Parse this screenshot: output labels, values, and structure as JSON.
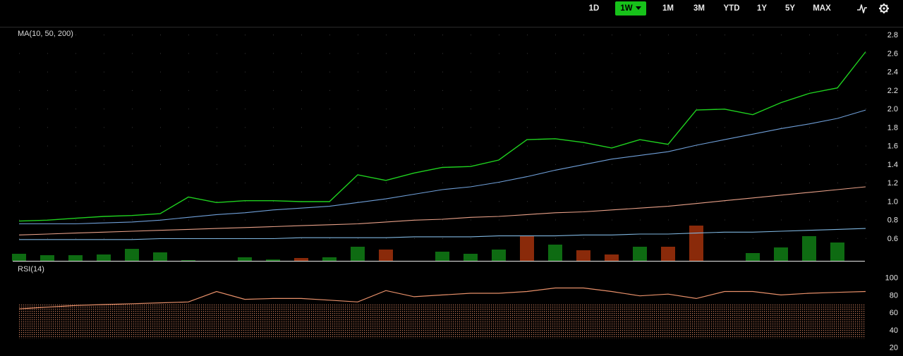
{
  "toolbar": {
    "ranges": [
      {
        "label": "1D",
        "active": false
      },
      {
        "label": "1W",
        "active": true
      },
      {
        "label": "1M",
        "active": false
      },
      {
        "label": "3M",
        "active": false
      },
      {
        "label": "YTD",
        "active": false
      },
      {
        "label": "1Y",
        "active": false
      },
      {
        "label": "5Y",
        "active": false
      },
      {
        "label": "MAX",
        "active": false
      }
    ],
    "icons": [
      "chart-type-icon",
      "gear-icon"
    ]
  },
  "colors": {
    "price": "#1fd11f",
    "ma10": "#6f9fd8",
    "ma50": "#e8a088",
    "ma200": "#7fb6e0",
    "vol_up": "#0e6b12",
    "vol_down": "#8a2a0a",
    "rsi": "#e8906a",
    "grid": "#2b2b2b",
    "active": "#17c21a"
  },
  "chart_data": [
    {
      "type": "line",
      "title": "MA(10, 50, 200)",
      "x": [
        0,
        1,
        2,
        3,
        4,
        5,
        6,
        7,
        8,
        9,
        10,
        11,
        12,
        13,
        14,
        15,
        16,
        17,
        18,
        19,
        20,
        21,
        22,
        23,
        24,
        25,
        26,
        27,
        28,
        29,
        30
      ],
      "ylim": [
        0.4,
        2.9
      ],
      "yticks": [
        "2.8",
        "2.6",
        "2.4",
        "2.2",
        "2.0",
        "1.8",
        "1.6",
        "1.4",
        "1.2",
        "1.0",
        "0.8",
        "0.6"
      ],
      "grid": true,
      "series": [
        {
          "key": "price",
          "values": [
            0.83,
            0.84,
            0.86,
            0.88,
            0.89,
            0.91,
            1.09,
            1.03,
            1.05,
            1.05,
            1.04,
            1.04,
            1.33,
            1.27,
            1.35,
            1.41,
            1.42,
            1.49,
            1.71,
            1.72,
            1.68,
            1.62,
            1.71,
            1.66,
            2.03,
            2.04,
            1.98,
            2.11,
            2.21,
            2.27,
            2.66
          ]
        },
        {
          "key": "ma10",
          "values": [
            0.8,
            0.8,
            0.8,
            0.81,
            0.82,
            0.84,
            0.87,
            0.9,
            0.92,
            0.95,
            0.97,
            0.99,
            1.03,
            1.07,
            1.12,
            1.17,
            1.2,
            1.25,
            1.31,
            1.38,
            1.44,
            1.5,
            1.54,
            1.58,
            1.65,
            1.71,
            1.77,
            1.83,
            1.88,
            1.94,
            2.03
          ]
        },
        {
          "key": "ma50",
          "values": [
            0.68,
            0.69,
            0.7,
            0.71,
            0.72,
            0.73,
            0.74,
            0.75,
            0.76,
            0.77,
            0.78,
            0.79,
            0.8,
            0.82,
            0.84,
            0.85,
            0.87,
            0.88,
            0.9,
            0.92,
            0.93,
            0.95,
            0.97,
            0.99,
            1.02,
            1.05,
            1.08,
            1.11,
            1.14,
            1.17,
            1.2
          ]
        },
        {
          "key": "ma200",
          "values": [
            0.63,
            0.63,
            0.63,
            0.63,
            0.63,
            0.64,
            0.64,
            0.64,
            0.64,
            0.64,
            0.65,
            0.65,
            0.65,
            0.65,
            0.66,
            0.66,
            0.66,
            0.67,
            0.67,
            0.67,
            0.68,
            0.68,
            0.69,
            0.69,
            0.7,
            0.71,
            0.71,
            0.72,
            0.73,
            0.74,
            0.75
          ]
        }
      ]
    },
    {
      "type": "bar",
      "title": "",
      "x": [
        0,
        1,
        2,
        3,
        4,
        5,
        6,
        7,
        8,
        9,
        10,
        11,
        12,
        13,
        14,
        15,
        16,
        17,
        18,
        19,
        20,
        21,
        22,
        23,
        24,
        25,
        26,
        27,
        28,
        29
      ],
      "values": [
        10,
        8,
        8,
        9,
        17,
        12,
        1,
        0,
        5,
        2,
        4,
        5,
        20,
        16,
        0,
        13,
        10,
        16,
        36,
        23,
        15,
        9,
        20,
        20,
        50,
        0,
        11,
        19,
        35,
        26
      ],
      "direction": [
        "up",
        "up",
        "up",
        "up",
        "up",
        "up",
        "up",
        "up",
        "up",
        "up",
        "down",
        "up",
        "up",
        "down",
        "up",
        "up",
        "up",
        "up",
        "down",
        "up",
        "down",
        "down",
        "up",
        "down",
        "down",
        "up",
        "up",
        "up",
        "up",
        "up"
      ],
      "ylim": [
        0,
        52
      ]
    },
    {
      "type": "area",
      "title": "RSI(14)",
      "x": [
        0,
        1,
        2,
        3,
        4,
        5,
        6,
        7,
        8,
        9,
        10,
        11,
        12,
        13,
        14,
        15,
        16,
        17,
        18,
        19,
        20,
        21,
        22,
        23,
        24,
        25,
        26,
        27,
        28,
        29,
        30
      ],
      "values": [
        64,
        66,
        68,
        69,
        70,
        71,
        72,
        84,
        75,
        76,
        76,
        74,
        72,
        85,
        78,
        80,
        82,
        82,
        84,
        88,
        88,
        84,
        79,
        81,
        76,
        84,
        84,
        80,
        82,
        83,
        84,
        89
      ],
      "ylim": [
        14,
        103
      ],
      "yticks": [
        "100",
        "80",
        "60",
        "40",
        "20"
      ],
      "band": [
        30,
        70
      ]
    }
  ]
}
